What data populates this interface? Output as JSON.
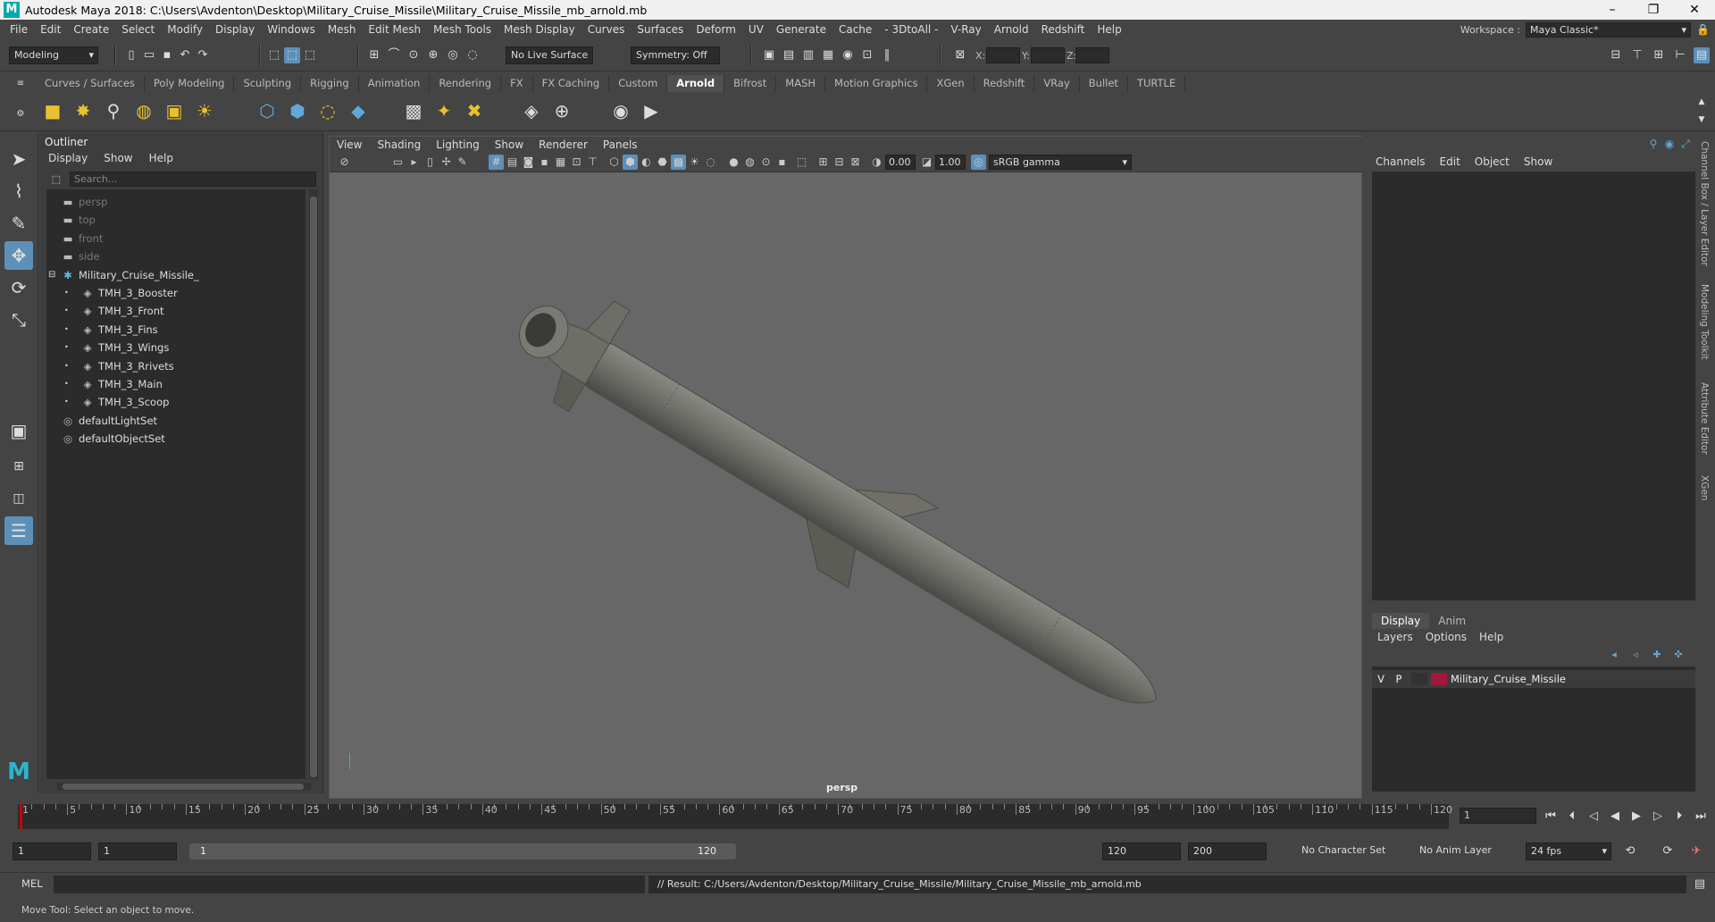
{
  "titlebar": {
    "title": "Autodesk Maya 2018: C:\\Users\\Avdenton\\Desktop\\Military_Cruise_Missile\\Military_Cruise_Missile_mb_arnold.mb",
    "logo": "M",
    "minimize": "–",
    "maximize": "❐",
    "close": "✕"
  },
  "menubar": {
    "items": [
      "File",
      "Edit",
      "Create",
      "Select",
      "Modify",
      "Display",
      "Windows",
      "Mesh",
      "Edit Mesh",
      "Mesh Tools",
      "Mesh Display",
      "Curves",
      "Surfaces",
      "Deform",
      "UV",
      "Generate",
      "Cache",
      "- 3DtoAll -",
      "V-Ray",
      "Arnold",
      "Redshift",
      "Help"
    ],
    "workspace_label": "Workspace :",
    "workspace_value": "Maya Classic*"
  },
  "status": {
    "mode": "Modeling",
    "live_surface": "No Live Surface",
    "symmetry": "Symmetry: Off",
    "x": "X:",
    "y": "Y:",
    "z": "Z:"
  },
  "shelf": {
    "tabs": [
      "Curves / Surfaces",
      "Poly Modeling",
      "Sculpting",
      "Rigging",
      "Animation",
      "Rendering",
      "FX",
      "FX Caching",
      "Custom",
      "Arnold",
      "Bifrost",
      "MASH",
      "Motion Graphics",
      "XGen",
      "Redshift",
      "VRay",
      "Bullet",
      "TURTLE"
    ],
    "active": "Arnold"
  },
  "outliner": {
    "title": "Outliner",
    "menu": [
      "Display",
      "Show",
      "Help"
    ],
    "search_placeholder": "Search...",
    "rows": [
      {
        "label": "persp",
        "icon": "camera-icon",
        "dim": true,
        "indent": 0
      },
      {
        "label": "top",
        "icon": "camera-icon",
        "dim": true,
        "indent": 0
      },
      {
        "label": "front",
        "icon": "camera-icon",
        "dim": true,
        "indent": 0
      },
      {
        "label": "side",
        "icon": "camera-icon",
        "dim": true,
        "indent": 0
      },
      {
        "label": "Military_Cruise_Missile_",
        "icon": "group-icon",
        "dim": false,
        "indent": 0,
        "expander": "⊟"
      },
      {
        "label": "TMH_3_Booster",
        "icon": "mesh-icon",
        "dim": false,
        "indent": 1
      },
      {
        "label": "TMH_3_Front",
        "icon": "mesh-icon",
        "dim": false,
        "indent": 1
      },
      {
        "label": "TMH_3_Fins",
        "icon": "mesh-icon",
        "dim": false,
        "indent": 1
      },
      {
        "label": "TMH_3_Wings",
        "icon": "mesh-icon",
        "dim": false,
        "indent": 1
      },
      {
        "label": "TMH_3_Rrivets",
        "icon": "mesh-icon",
        "dim": false,
        "indent": 1
      },
      {
        "label": "TMH_3_Main",
        "icon": "mesh-icon",
        "dim": false,
        "indent": 1
      },
      {
        "label": "TMH_3_Scoop",
        "icon": "mesh-icon",
        "dim": false,
        "indent": 1
      },
      {
        "label": "defaultLightSet",
        "icon": "set-icon",
        "dim": false,
        "indent": 0
      },
      {
        "label": "defaultObjectSet",
        "icon": "set-icon",
        "dim": false,
        "indent": 0
      }
    ]
  },
  "viewport": {
    "menu": [
      "View",
      "Shading",
      "Lighting",
      "Show",
      "Renderer",
      "Panels"
    ],
    "exposure": "0.00",
    "gamma": "1.00",
    "colorspace": "sRGB gamma",
    "camera": "persp"
  },
  "channelbox": {
    "menu": [
      "Channels",
      "Edit",
      "Object",
      "Show"
    ],
    "tabs": [
      "Display",
      "Anim"
    ],
    "layer_menu": [
      "Layers",
      "Options",
      "Help"
    ],
    "layer": {
      "v": "V",
      "p": "P",
      "name": "Military_Cruise_Missile",
      "color": "#a0183a"
    }
  },
  "rightstrip": [
    "Channel Box / Layer Editor",
    "Modeling Toolkit",
    "Attribute Editor",
    "XGen"
  ],
  "timeline": {
    "ticks": [
      "1",
      "5",
      "10",
      "15",
      "20",
      "25",
      "30",
      "35",
      "40",
      "45",
      "50",
      "55",
      "60",
      "65",
      "70",
      "75",
      "80",
      "85",
      "90",
      "95",
      "100",
      "105",
      "110",
      "115",
      "120"
    ],
    "current": "1"
  },
  "range": {
    "start": "1",
    "inner_start": "1",
    "slider_start": "1",
    "slider_end": "120",
    "end": "120",
    "max": "200",
    "char_set": "No Character Set",
    "anim_layer": "No Anim Layer",
    "fps": "24 fps"
  },
  "cmdline": {
    "label": "MEL",
    "result": "// Result: C:/Users/Avdenton/Desktop/Military_Cruise_Missile/Military_Cruise_Missile_mb_arnold.mb"
  },
  "help": "Move Tool: Select an object to move."
}
